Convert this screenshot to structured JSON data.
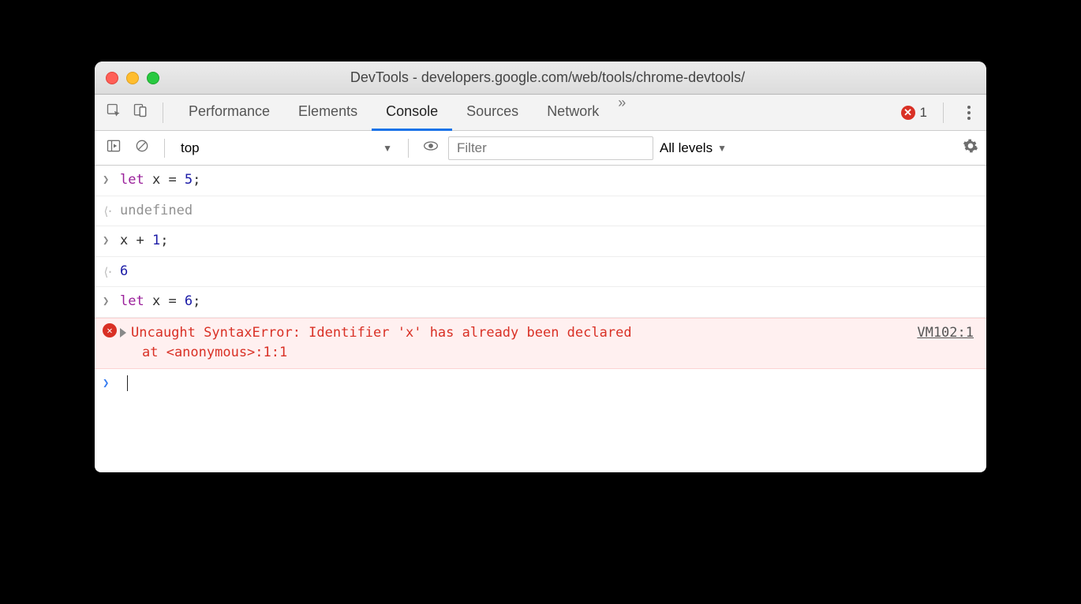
{
  "window": {
    "title": "DevTools - developers.google.com/web/tools/chrome-devtools/"
  },
  "toolbar": {
    "tabs": [
      "Performance",
      "Elements",
      "Console",
      "Sources",
      "Network"
    ],
    "activeTab": "Console",
    "overflow": "»",
    "errorCount": "1"
  },
  "filterbar": {
    "context": "top",
    "filterPlaceholder": "Filter",
    "levels": "All levels"
  },
  "console": {
    "lines": [
      {
        "type": "input",
        "tokens": [
          [
            "kw",
            "let"
          ],
          [
            "plaincode",
            " x "
          ],
          [
            "plaincode",
            "= "
          ],
          [
            "num",
            "5"
          ],
          [
            "plaincode",
            ";"
          ]
        ]
      },
      {
        "type": "output",
        "tokens": [
          [
            "undef",
            "undefined"
          ]
        ]
      },
      {
        "type": "input",
        "tokens": [
          [
            "plaincode",
            "x "
          ],
          [
            "plaincode",
            "+ "
          ],
          [
            "num",
            "1"
          ],
          [
            "plaincode",
            ";"
          ]
        ]
      },
      {
        "type": "output",
        "tokens": [
          [
            "num",
            "6"
          ]
        ]
      },
      {
        "type": "input",
        "tokens": [
          [
            "kw",
            "let"
          ],
          [
            "plaincode",
            " x "
          ],
          [
            "plaincode",
            "= "
          ],
          [
            "num",
            "6"
          ],
          [
            "plaincode",
            ";"
          ]
        ]
      }
    ],
    "error": {
      "message": "Uncaught SyntaxError: Identifier 'x' has already been declared",
      "stack": "at <anonymous>:1:1",
      "location": "VM102:1"
    }
  }
}
